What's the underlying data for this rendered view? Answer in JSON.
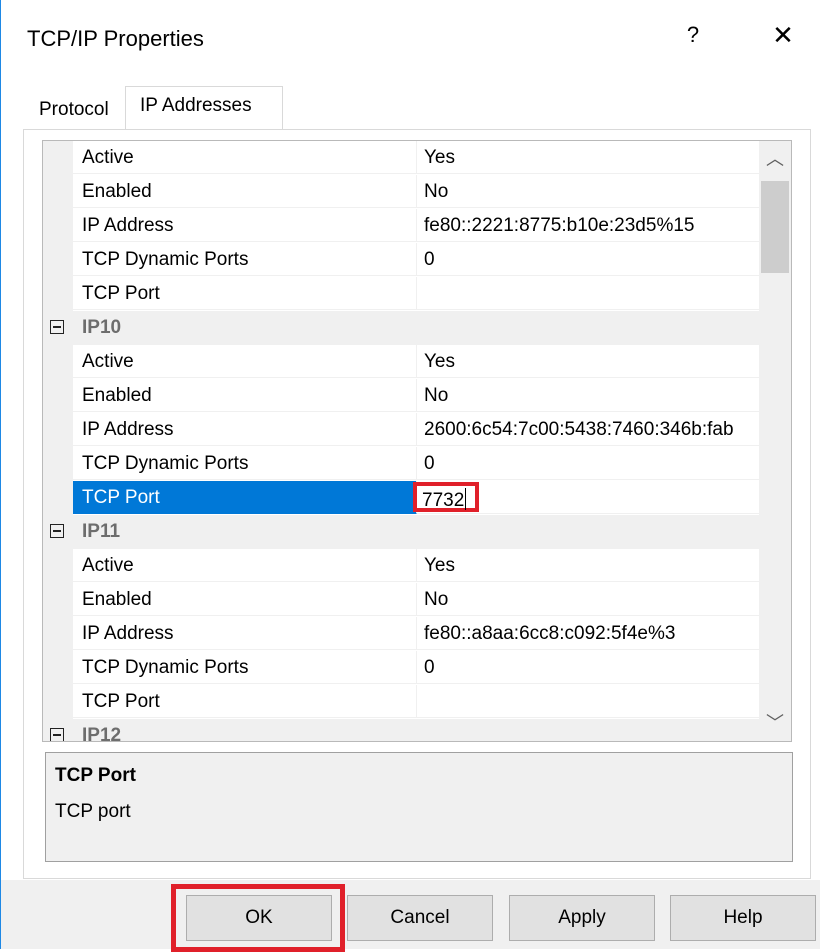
{
  "window": {
    "title": "TCP/IP Properties",
    "help_label": "?",
    "close_label": "✕"
  },
  "tabs": {
    "protocol": "Protocol",
    "ip_addresses": "IP Addresses",
    "selected": "IP Addresses"
  },
  "grid": {
    "rows": [
      {
        "kind": "prop",
        "name": "Active",
        "value": "Yes"
      },
      {
        "kind": "prop",
        "name": "Enabled",
        "value": "No"
      },
      {
        "kind": "prop",
        "name": "IP Address",
        "value": "fe80::2221:8775:b10e:23d5%15"
      },
      {
        "kind": "prop",
        "name": "TCP Dynamic Ports",
        "value": "0"
      },
      {
        "kind": "prop",
        "name": "TCP Port",
        "value": ""
      },
      {
        "kind": "group",
        "name": "IP10",
        "value": ""
      },
      {
        "kind": "prop",
        "name": "Active",
        "value": "Yes"
      },
      {
        "kind": "prop",
        "name": "Enabled",
        "value": "No"
      },
      {
        "kind": "prop",
        "name": "IP Address",
        "value": "2600:6c54:7c00:5438:7460:346b:fab"
      },
      {
        "kind": "prop",
        "name": "TCP Dynamic Ports",
        "value": "0"
      },
      {
        "kind": "prop",
        "name": "TCP Port",
        "value": "7732",
        "selected": true,
        "editing": true
      },
      {
        "kind": "group",
        "name": "IP11",
        "value": ""
      },
      {
        "kind": "prop",
        "name": "Active",
        "value": "Yes"
      },
      {
        "kind": "prop",
        "name": "Enabled",
        "value": "No"
      },
      {
        "kind": "prop",
        "name": "IP Address",
        "value": "fe80::a8aa:6cc8:c092:5f4e%3"
      },
      {
        "kind": "prop",
        "name": "TCP Dynamic Ports",
        "value": "0"
      },
      {
        "kind": "prop",
        "name": "TCP Port",
        "value": ""
      },
      {
        "kind": "group",
        "name": "IP12",
        "value": ""
      }
    ],
    "scroll_up_icon": "chevron-up-icon",
    "scroll_down_icon": "chevron-down-icon"
  },
  "description": {
    "title": "TCP Port",
    "text": "TCP port"
  },
  "buttons": {
    "ok": "OK",
    "cancel": "Cancel",
    "apply": "Apply",
    "help": "Help"
  },
  "colors": {
    "selection": "#0078d7",
    "highlight_annotation": "#e0202a",
    "window_border": "#1e88e5"
  }
}
